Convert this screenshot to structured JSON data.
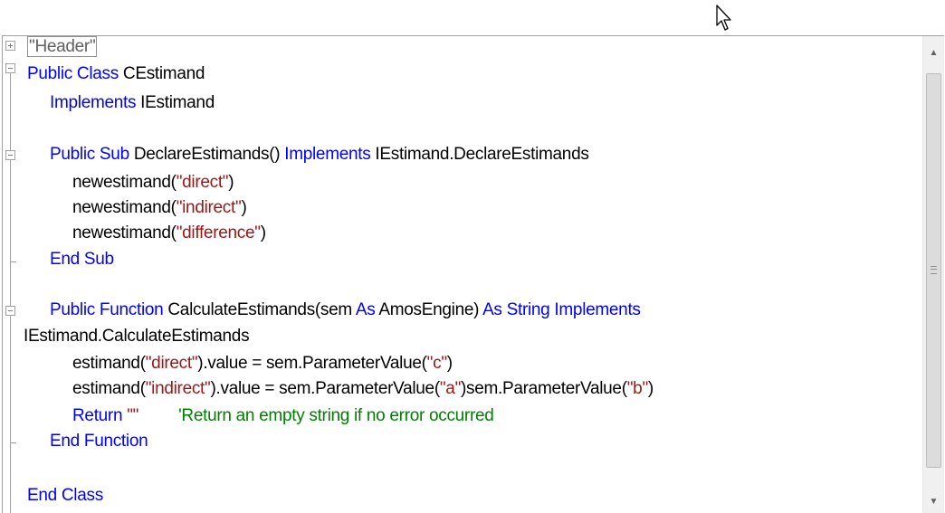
{
  "icons": {
    "cursor": "arrow-pointer-icon",
    "collapse": "minus-box-icon",
    "expand": "plus-box-icon",
    "scroll_up": "chevron-up-icon",
    "scroll_down": "chevron-down-icon"
  },
  "colors": {
    "keyword": "#0000ff",
    "string": "#a31515",
    "comment": "#008000",
    "text": "#000000"
  },
  "code": {
    "header_region": "\"Header\"",
    "l1": {
      "kw1": "Public Class",
      "name": " CEstimand"
    },
    "l2": {
      "kw1": "Implements",
      "name": " IEstimand"
    },
    "l4": {
      "kw1": "Public Sub",
      "name": " DeclareEstimands() ",
      "kw2": "Implements",
      "tail": " IEstimand.DeclareEstimands"
    },
    "l5": {
      "fn": "newestimand(",
      "arg": "\"direct\"",
      "close": ")"
    },
    "l6": {
      "fn": "newestimand(",
      "arg": "\"indirect\"",
      "close": ")"
    },
    "l7": {
      "fn": "newestimand(",
      "arg": "\"difference\"",
      "close": ")"
    },
    "l8": {
      "kw1": "End Sub"
    },
    "l10": {
      "kw1": "Public Function",
      "name": " CalculateEstimands(sem ",
      "kw2": "As",
      "mid": " AmosEngine) ",
      "kw3": "As String Implements"
    },
    "l11": {
      "text": "IEstimand.CalculateEstimands"
    },
    "l12": {
      "a": "estimand(",
      "s1": "\"direct\"",
      "b": ").value = sem.ParameterValue(",
      "s2": "\"c\"",
      "c": ")"
    },
    "l13": {
      "a": "estimand(",
      "s1": "\"indirect\"",
      "b": ").value = sem.ParameterValue(",
      "s2": "\"a\"",
      "c": ")sem.ParameterValue(",
      "s3": "\"b\"",
      "d": ")"
    },
    "l14": {
      "kw1": "Return",
      "str": " \"\"",
      "cmt": "'Return an empty string if no error occurred"
    },
    "l15": {
      "kw1": "End Function"
    },
    "l17": {
      "kw1": "End Class"
    }
  }
}
